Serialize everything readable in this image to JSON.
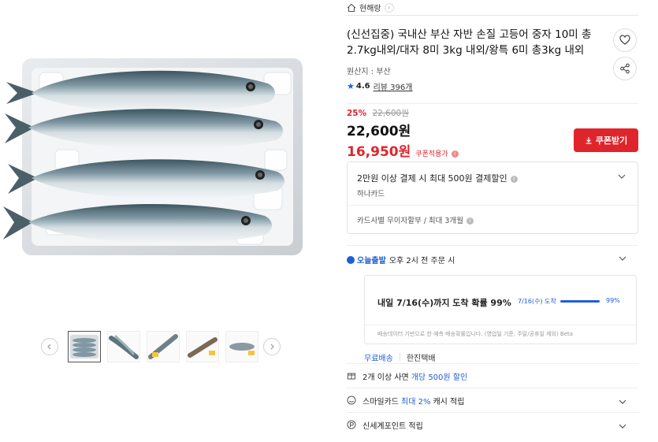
{
  "brand": {
    "name": "현해랑"
  },
  "product": {
    "title": "(신선집중) 국내산 부산 자반 손질 고등어 중자 10미 총 2.7kg내외/대자 8미 3kg 내외/왕특 6미 총3kg 내외",
    "origin": "원산지 : 부산",
    "rating": "4.6",
    "review_count": "리뷰 396개"
  },
  "price": {
    "discount_rate": "25%",
    "original": "22,600원",
    "current": "22,600원",
    "coupon_price": "16,950원",
    "coupon_note": "쿠폰적용가",
    "coupon_button": "쿠폰받기"
  },
  "card_benefit": {
    "line1": "2만원 이상 결제 시 최대 500원 결제할인",
    "card": "하나카드",
    "installment": "카드사별 무이자할부 / 최대 3개월"
  },
  "delivery": {
    "badge": "오늘출발",
    "cutoff": "오후 2시 전 주문 시",
    "forecast_main": "내일 7/16(수)까지 도착 확률 99%",
    "forecast_date": "7/16(수) 도착",
    "forecast_pct": "99%",
    "forecast_value": 0.99,
    "forecast_note": "배송데이터 기반으로 한 예측 배송확률입니다. (영업일 기준, 주말/공휴일 제외) Beta",
    "free_shipping": "무료배송",
    "carrier": "한진택배"
  },
  "benefits": [
    {
      "pre": "2개 이상 사면",
      "hl": "개당 500원 할인",
      "post": "",
      "icon": "bundle-icon"
    },
    {
      "pre": "스마일카드",
      "hl": "최대 2%",
      "post": "캐시 적립",
      "icon": "smile-card-icon"
    },
    {
      "pre": "신세계포인트 적립",
      "hl": "",
      "post": "",
      "icon": "point-icon"
    }
  ],
  "colors": {
    "accent_red": "#e0242c",
    "accent_blue": "#1f5fd6"
  },
  "thumbnails": [
    "thumb-1",
    "thumb-2",
    "thumb-3",
    "thumb-4",
    "thumb-5"
  ]
}
